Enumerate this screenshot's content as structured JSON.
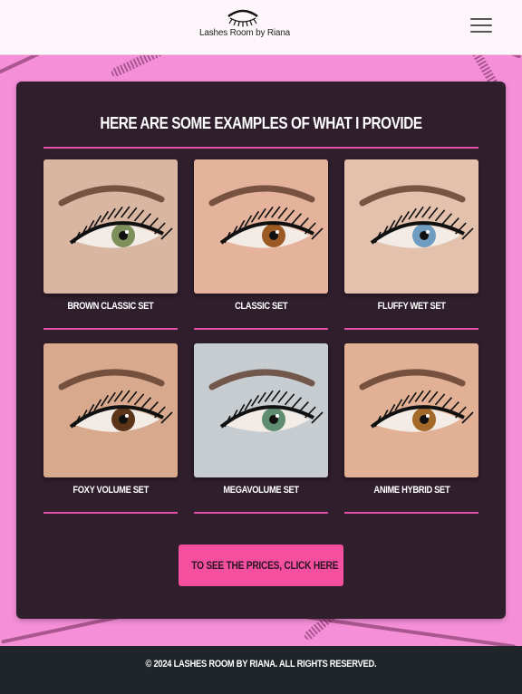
{
  "header": {
    "brand": "Lashes Room by Riana",
    "menu_icon": "hamburger-menu-icon"
  },
  "section": {
    "title": "HERE ARE SOME EXAMPLES OF WHAT I PROVIDE",
    "items": [
      {
        "label": "BROWN CLASSIC SET",
        "skin": "#d9b6a1",
        "iris": "#7d8f5a"
      },
      {
        "label": "CLASSIC SET",
        "skin": "#e5b29c",
        "iris": "#9b5a24"
      },
      {
        "label": "FLUFFY WET SET",
        "skin": "#e3c1ad",
        "iris": "#6f9cc0"
      },
      {
        "label": "FOXY VOLUME SET",
        "skin": "#d8a98c",
        "iris": "#5c3518"
      },
      {
        "label": "MEGAVOLUME SET",
        "skin": "#c7ccd0",
        "iris": "#5f8d6f"
      },
      {
        "label": "ANIME HYBRID SET",
        "skin": "#e2b094",
        "iris": "#a46a2a"
      }
    ]
  },
  "cta": {
    "label": "TO SEE THE PRICES, CLICK HERE"
  },
  "footer": {
    "text": "© 2024 LASHES ROOM BY RIANA. ALL RIGHTS RESERVED."
  },
  "colors": {
    "background": "#f58fd8",
    "panel": "#2f1e2c",
    "accent": "#e14ea6",
    "button": "#f5509f",
    "footer": "#1f2529"
  }
}
